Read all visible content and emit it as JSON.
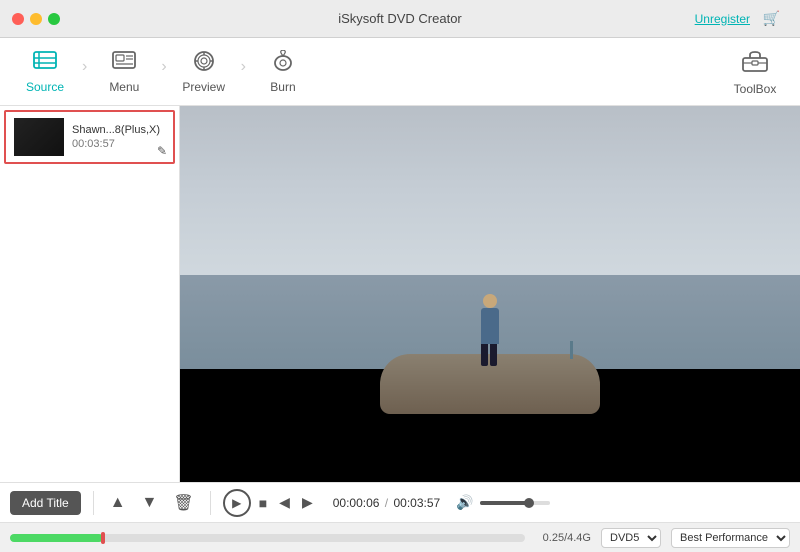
{
  "app": {
    "title": "iSkysoft DVD Creator",
    "unregister_label": "Unregister"
  },
  "toolbar": {
    "items": [
      {
        "id": "source",
        "label": "Source",
        "active": true
      },
      {
        "id": "menu",
        "label": "Menu",
        "active": false
      },
      {
        "id": "preview",
        "label": "Preview",
        "active": false
      },
      {
        "id": "burn",
        "label": "Burn",
        "active": false
      }
    ],
    "toolbox_label": "ToolBox"
  },
  "left_panel": {
    "video_item": {
      "name": "Shawn...8(Plus,X)",
      "duration": "00:03:57"
    }
  },
  "controls": {
    "add_title_label": "Add Title",
    "time_current": "00:00:06",
    "time_total": "00:03:57",
    "time_separator": "/"
  },
  "progress_bar": {
    "storage_info": "0.25/4.4G",
    "format": "DVD5",
    "quality": "Best Performance"
  }
}
